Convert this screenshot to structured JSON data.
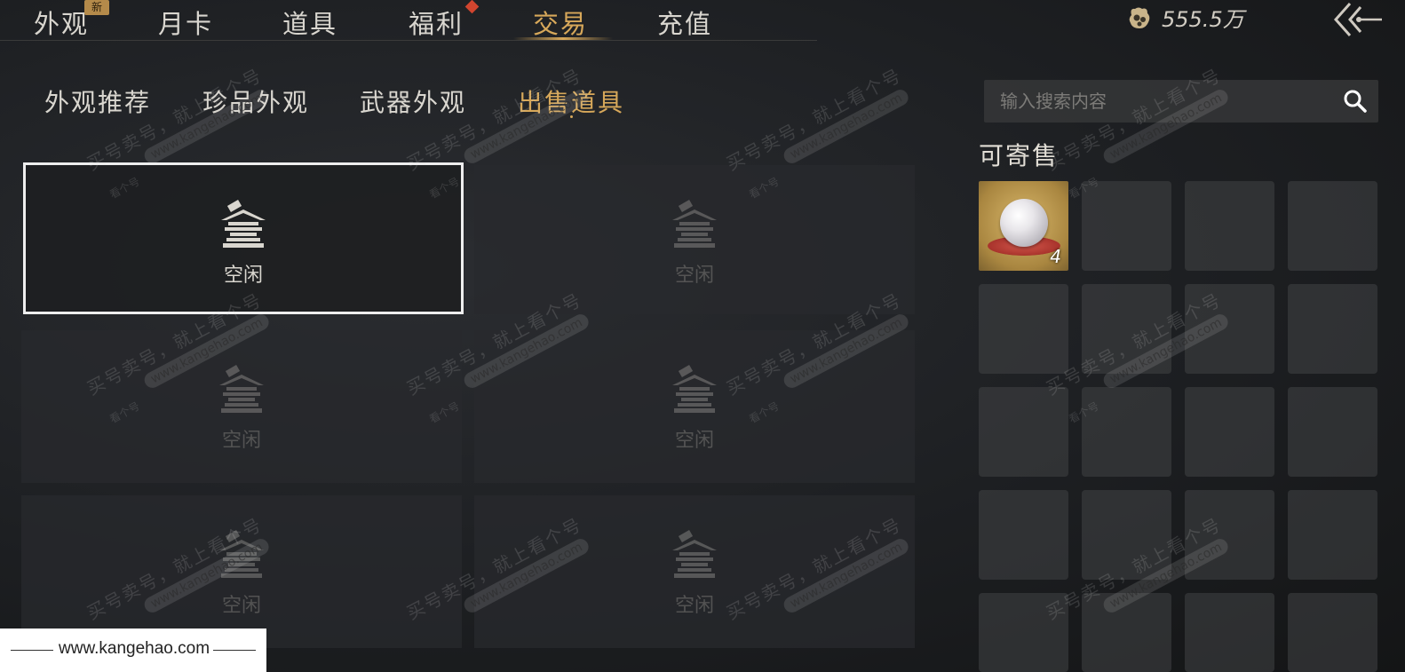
{
  "top_nav": {
    "tabs": [
      {
        "label": "外观",
        "new": true
      },
      {
        "label": "月卡"
      },
      {
        "label": "道具"
      },
      {
        "label": "福利",
        "dot": true
      },
      {
        "label": "交易",
        "active": true
      },
      {
        "label": "充值"
      }
    ],
    "new_badge": "新",
    "currency_icon": "coin-pouch-icon",
    "currency_amount": "555.5万",
    "back_icon": "back-arrow-icon"
  },
  "sub_tabs": [
    {
      "label": "外观推荐"
    },
    {
      "label": "珍品外观"
    },
    {
      "label": "武器外观"
    },
    {
      "label": "出售道具",
      "active": true
    }
  ],
  "slots": {
    "label": "空闲",
    "icon": "pavilion-icon",
    "items": [
      {
        "label": "空闲",
        "selected": true
      },
      {
        "label": "空闲"
      },
      {
        "label": "空闲"
      },
      {
        "label": "空闲"
      },
      {
        "label": "空闲"
      },
      {
        "label": "空闲"
      }
    ]
  },
  "search": {
    "placeholder": "输入搜索内容",
    "icon": "search-icon"
  },
  "sellable": {
    "title": "可寄售",
    "items": [
      {
        "name": "pearl",
        "count": "4"
      }
    ]
  },
  "watermark": {
    "line1": "买号卖号，就上看个号",
    "line2": "www.kangehao.com",
    "line3": "看个号"
  },
  "footer": {
    "text": "www.kangehao.com"
  }
}
